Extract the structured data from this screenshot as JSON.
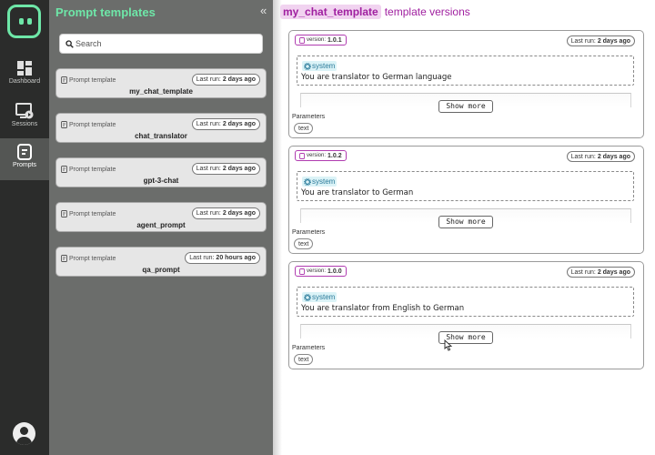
{
  "nav": {
    "items": [
      {
        "label": "Dashboard",
        "icon": "dashboard-icon"
      },
      {
        "label": "Sessions",
        "icon": "sessions-icon"
      },
      {
        "label": "Prompts",
        "icon": "prompts-icon"
      }
    ],
    "active_color": "#545654",
    "accent": "#6ee7a8"
  },
  "panel": {
    "title": "Prompt templates",
    "collapse_icon": "double-chevron-left-icon",
    "search_placeholder": "Search",
    "templates": [
      {
        "kind": "Prompt template",
        "last_run_label": "Last run:",
        "last_run": "2 days ago",
        "name": "my_chat_template"
      },
      {
        "kind": "Prompt template",
        "last_run_label": "Last run:",
        "last_run": "2 days ago",
        "name": "chat_translator"
      },
      {
        "kind": "Prompt template",
        "last_run_label": "Last run:",
        "last_run": "2 days ago",
        "name": "gpt-3-chat"
      },
      {
        "kind": "Prompt template",
        "last_run_label": "Last run:",
        "last_run": "2 days ago",
        "name": "agent_prompt"
      },
      {
        "kind": "Prompt template",
        "last_run_label": "Last run:",
        "last_run": "20 hours ago",
        "name": "qa_prompt"
      }
    ]
  },
  "main": {
    "template_name": "my_chat_template",
    "title_suffix": "template versions",
    "versions": [
      {
        "version_label": "version:",
        "version": "1.0.1",
        "last_run_label": "Last run:",
        "last_run": "2 days ago",
        "role": "system",
        "content": "You are translator to German language",
        "show_more": "Show more",
        "params_label": "Parameters",
        "params": [
          "text"
        ]
      },
      {
        "version_label": "version:",
        "version": "1.0.2",
        "last_run_label": "Last run:",
        "last_run": "2 days ago",
        "role": "system",
        "content": "You are translator to German",
        "show_more": "Show more",
        "params_label": "Parameters",
        "params": [
          "text"
        ]
      },
      {
        "version_label": "version:",
        "version": "1.0.0",
        "last_run_label": "Last run:",
        "last_run": "2 days ago",
        "role": "system",
        "content": "You are translator from English to German",
        "show_more": "Show more",
        "params_label": "Parameters",
        "params": [
          "text"
        ]
      }
    ],
    "colors": {
      "title": "#a020a0",
      "role_bg": "#dbf3f7",
      "role_text": "#2a7a9a"
    }
  }
}
